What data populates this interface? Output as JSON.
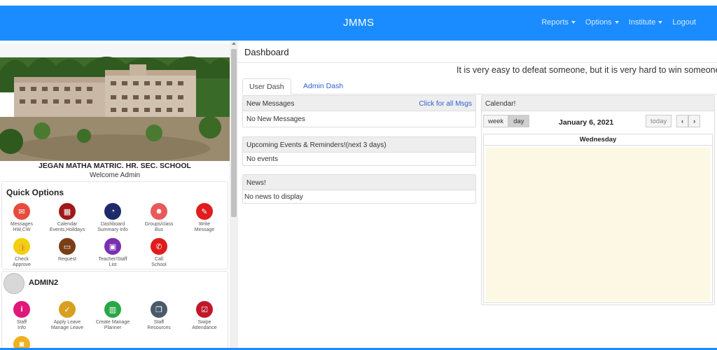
{
  "app": {
    "brand": "JMMS"
  },
  "nav": {
    "reports": "Reports",
    "options": "Options",
    "institute": "Institute",
    "logout": "Logout"
  },
  "sidebar": {
    "school_name": "JEGAN MATHA MATRIC. HR. SEC. SCHOOL",
    "welcome": "Welcome Admin",
    "quick_options_title": "Quick Options",
    "quick_options": [
      {
        "label": "Messages\nHW,CW",
        "icon": "envelope-icon",
        "color": "#e74c3c"
      },
      {
        "label": "Calendar\nEvents,Holidays",
        "icon": "calendar-icon",
        "color": "#a01818"
      },
      {
        "label": "Dashboard\nSummary Info",
        "icon": "pie-chart-icon",
        "color": "#1f2a6b"
      },
      {
        "label": "Groups/class\nBus",
        "icon": "users-icon",
        "color": "#e85a5a"
      },
      {
        "label": "Write\nMessage",
        "icon": "pencil-icon",
        "color": "#e01c1c"
      },
      {
        "label": "Check\nApprove",
        "icon": "thumbs-up-icon",
        "color": "#f0d010"
      },
      {
        "label": "Request",
        "icon": "card-icon",
        "color": "#7a3e16"
      },
      {
        "label": "Teacher/Staff\nList",
        "icon": "chalkboard-icon",
        "color": "#7b2fb0"
      },
      {
        "label": "Call\nSchool",
        "icon": "phone-icon",
        "color": "#e01c1c"
      }
    ],
    "admin_name": "ADMIN2",
    "admin_options": [
      {
        "label": "Staff\nInfo",
        "icon": "info-icon",
        "color": "#e0187a"
      },
      {
        "label": "Apply Leave\nManage Leave",
        "icon": "calendar-check-icon",
        "color": "#d8a020"
      },
      {
        "label": "Create Manage\nPlanner",
        "icon": "planner-icon",
        "color": "#28a745"
      },
      {
        "label": "Staff\nResources",
        "icon": "copy-icon",
        "color": "#4a5a6a"
      },
      {
        "label": "Swipe\nAttendance",
        "icon": "check-square-icon",
        "color": "#c0182a"
      }
    ]
  },
  "main": {
    "title": "Dashboard",
    "marquee": "It is very easy to defeat someone, but it is very hard to win someone",
    "tabs": [
      "User Dash",
      "Admin Dash"
    ],
    "messages": {
      "title": "New Messages",
      "link": "Click for all Msgs",
      "body": "No New Messages"
    },
    "events": {
      "title": "Upcoming Events & Reminders!(next 3 days)",
      "body": "No events"
    },
    "news": {
      "title": "News!",
      "body": "No news to display"
    },
    "calendar": {
      "title": "Calendar!",
      "week": "week",
      "day": "day",
      "date": "January 6, 2021",
      "today": "today",
      "prev": "‹",
      "next": "›",
      "weekday": "Wednesday"
    }
  }
}
